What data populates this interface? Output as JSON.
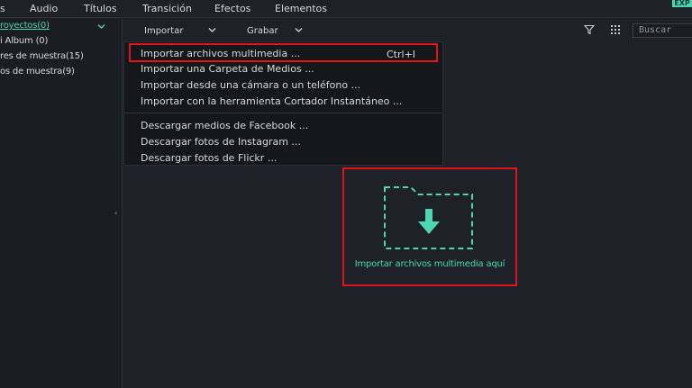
{
  "top_tabs": [
    "s",
    "Audio",
    "Títulos",
    "Transición",
    "Efectos",
    "Elementos"
  ],
  "badge": "EXP",
  "sidebar": {
    "items": [
      {
        "label": "royectos",
        "count": "(0)",
        "active": true
      },
      {
        "label": "i Album",
        "count": "(0)",
        "active": false
      },
      {
        "label": "res de muestra",
        "count": "(15)",
        "active": false
      },
      {
        "label": "os de muestra",
        "count": "(9)",
        "active": false
      }
    ]
  },
  "toolbar": {
    "import_label": "Importar",
    "record_label": "Grabar",
    "search_placeholder": "Buscar"
  },
  "import_menu": {
    "items": [
      {
        "label": "Importar archivos multimedia ...",
        "shortcut": "Ctrl+I"
      },
      {
        "label": "Importar una Carpeta de Medios ..."
      },
      {
        "label": "Importar desde una cámara o un teléfono ..."
      },
      {
        "label": "Importar con la herramienta Cortador Instantáneo ..."
      },
      {
        "label": "Descargar medios de Facebook ..."
      },
      {
        "label": "Descargar fotos de Instagram ..."
      },
      {
        "label": "Descargar fotos de Flickr ..."
      }
    ]
  },
  "dropzone": {
    "label": "Importar archivos multimedia aquí"
  },
  "colors": {
    "accent": "#4bd6b4",
    "highlight": "#e0141c",
    "background": "#1e2127"
  }
}
